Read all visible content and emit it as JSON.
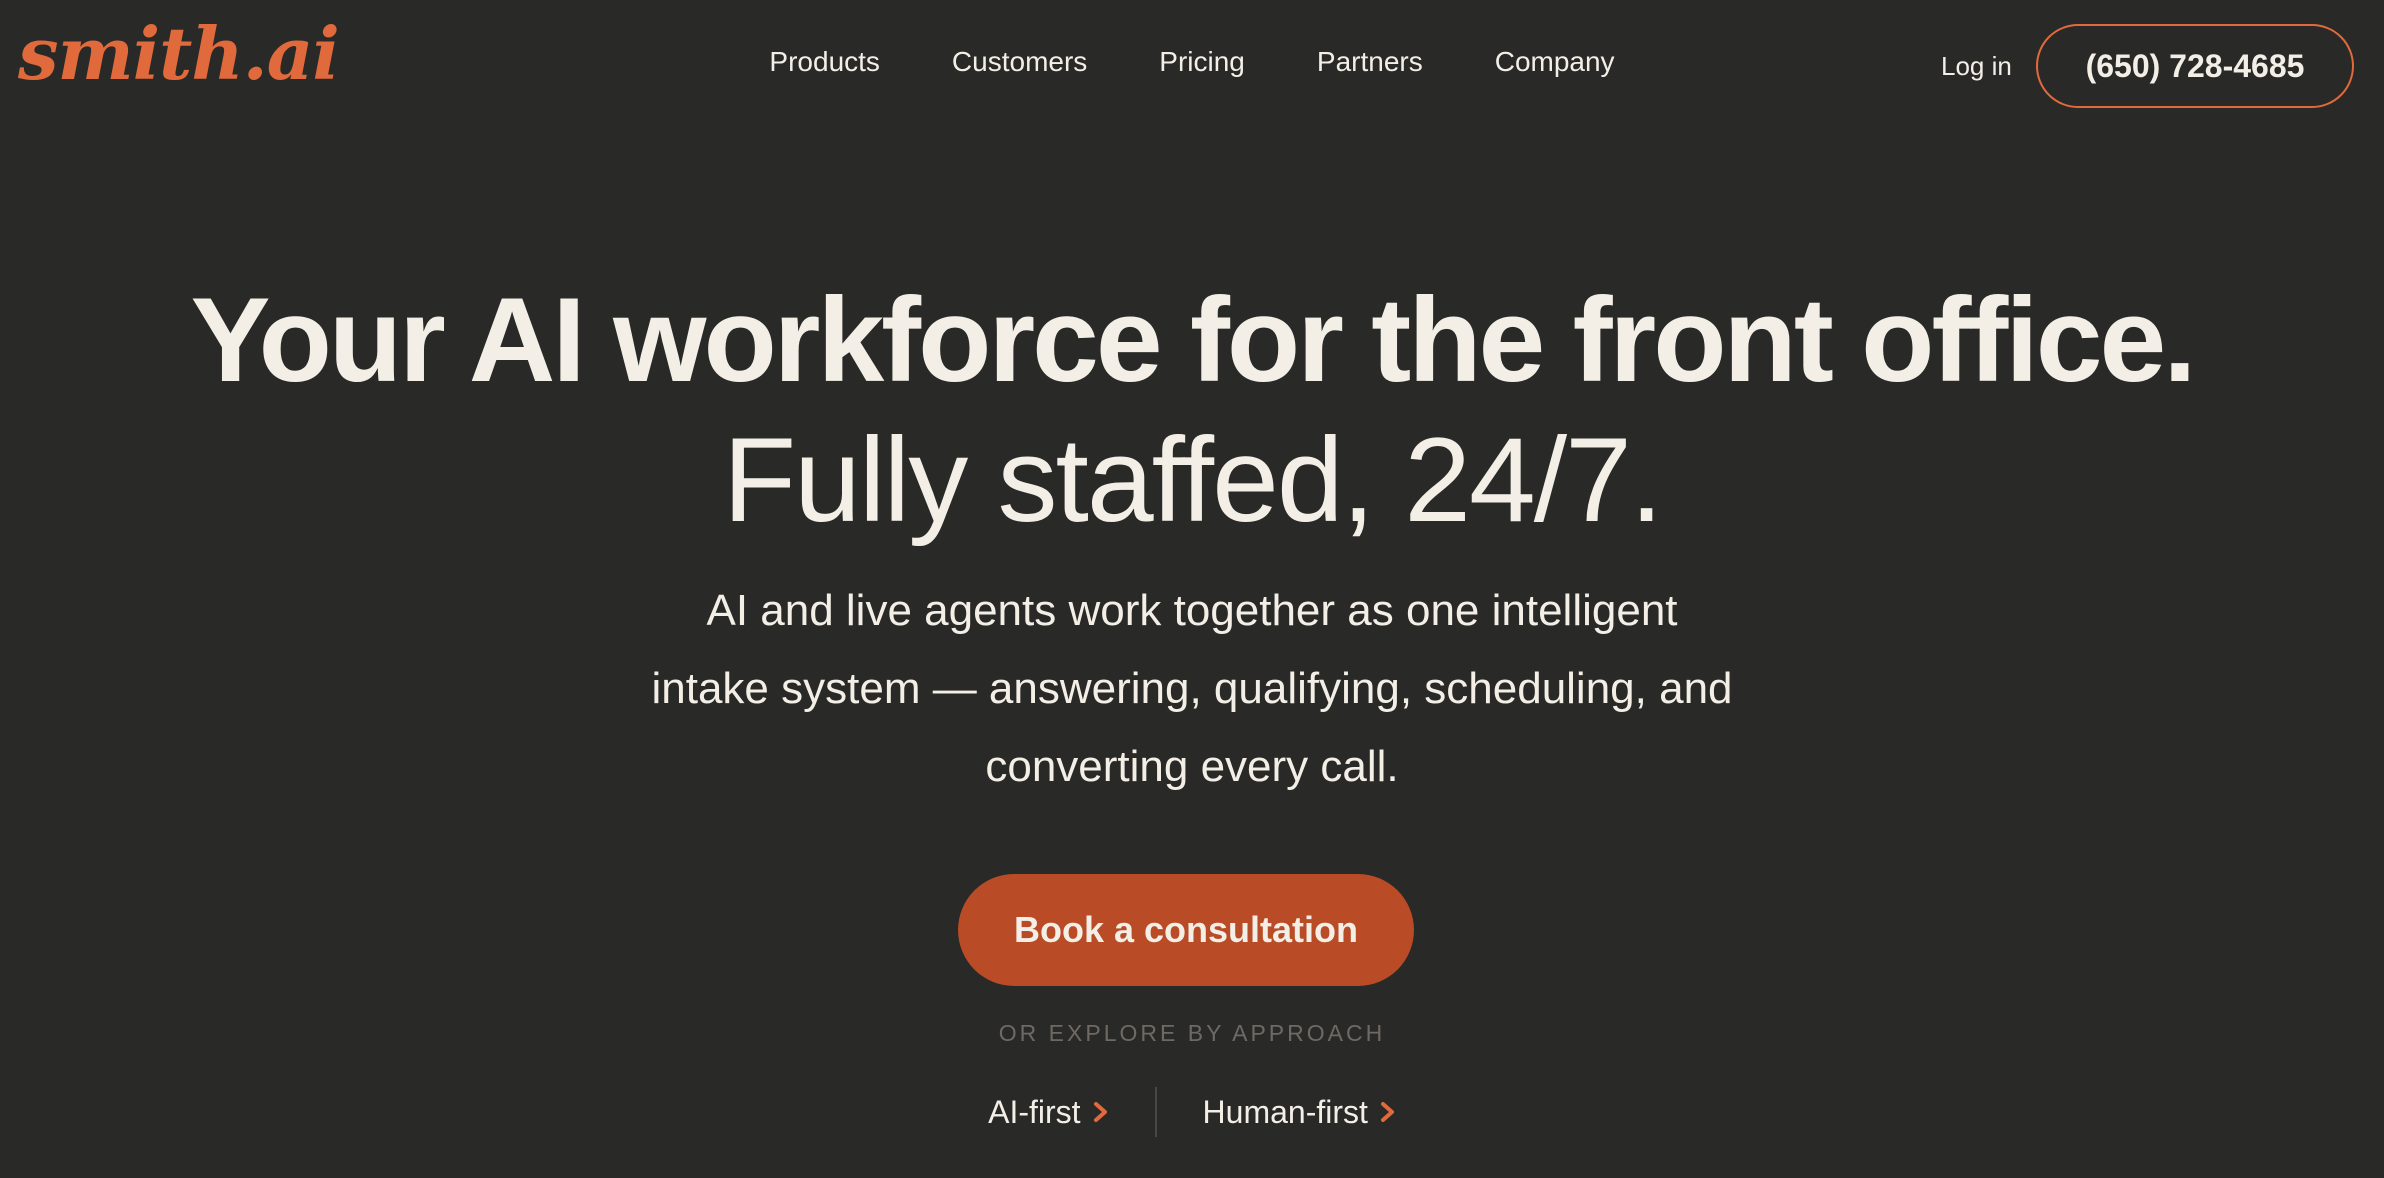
{
  "header": {
    "logo_text": "smith.ai",
    "nav": [
      {
        "label": "Products"
      },
      {
        "label": "Customers"
      },
      {
        "label": "Pricing"
      },
      {
        "label": "Partners"
      },
      {
        "label": "Company"
      }
    ],
    "login_label": "Log in",
    "phone_label": "(650) 728-4685"
  },
  "hero": {
    "headline": "Your AI workforce for the front office.",
    "subheadline": "Fully staffed, 24/7.",
    "description": "AI and live agents work together as one intelligent intake system — answering, qualifying, scheduling, and converting every call.",
    "cta_label": "Book a consultation",
    "explore_label": "OR EXPLORE BY APPROACH",
    "approaches": [
      {
        "label": "AI-first",
        "icon": "chevron-right-icon"
      },
      {
        "label": "Human-first",
        "icon": "chevron-right-icon"
      }
    ]
  },
  "colors": {
    "background": "#292927",
    "text": "#f3efe7",
    "accent": "#b94b26",
    "logo": "#e06a3c"
  }
}
